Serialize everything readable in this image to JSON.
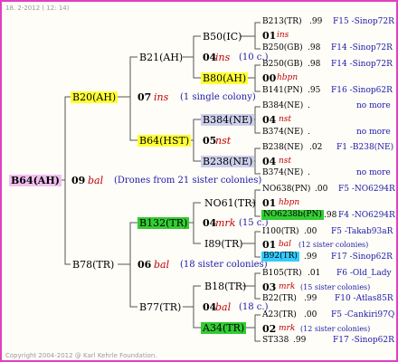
{
  "header": {
    "date_time": "18. 2-2012 ( 12: 14)"
  },
  "footer": {
    "copyright": "Copyright 2004-2012 @ Karl Kehrle Foundation."
  },
  "root": {
    "name": "B64(AH)",
    "gen": "09",
    "year": "bal",
    "note": "(Drones from 21 sister colonies)"
  },
  "mother": {
    "name": "B20(AH)",
    "gen": "07",
    "year": "ins",
    "note": "(1 single colony)"
  },
  "father": {
    "name": "B78(TR)",
    "gen": "06",
    "year": "bal",
    "note": "(18 sister colonies)"
  },
  "g3": {
    "b21": "B21(AH)",
    "b64hst": "B64(HST)",
    "b132": "B132(TR)",
    "b77": "B77(TR)"
  },
  "g4": {
    "b50": "B50(IC)",
    "b50_gen": "04",
    "b50_year": "ins",
    "b50_note": "(10 c.)",
    "b80": "B80(AH)",
    "b384": "B384(NE)",
    "b384_gen": "05",
    "b384_year": "nst",
    "b238": "B238(NE)",
    "no61": "NO61(TR)",
    "no61_gen": "04",
    "no61_year": "mrk",
    "no61_note": "(15 c.)",
    "i89": "I89(TR)",
    "b18": "B18(TR)",
    "b18_gen": "04",
    "b18_year": "bal",
    "b18_note": "(18 c.)",
    "a34": "A34(TR)"
  },
  "g5": [
    {
      "name": "B213(TR)",
      "pct": ".99",
      "ref": "F15 -Sinop72R"
    },
    {
      "gen": "01",
      "year": "ins"
    },
    {
      "name": "B250(GB)",
      "pct": ".98",
      "ref": "F14 -Sinop72R"
    },
    {
      "name": "B250(GB)",
      "pct": ".98",
      "ref": "F14 -Sinop72R"
    },
    {
      "gen": "00",
      "year": "hbpn"
    },
    {
      "name": "B141(PN)",
      "pct": ".95",
      "ref": "F16 -Sinop62R"
    },
    {
      "name": "B384(NE)",
      "pct": ".",
      "ref": "no more"
    },
    {
      "gen": "04",
      "year": "nst"
    },
    {
      "name": "B374(NE)",
      "pct": ".",
      "ref": "no more"
    },
    {
      "name": "B238(NE)",
      "pct": ".02",
      "ref": "F1 -B238(NE)"
    },
    {
      "gen": "04",
      "year": "nst"
    },
    {
      "name": "B374(NE)",
      "pct": ".",
      "ref": "no more"
    },
    {
      "name": "NO638(PN)",
      "pct": ".00",
      "ref": "F5 -NO6294R"
    },
    {
      "gen": "01",
      "year": "hbpn"
    },
    {
      "name": "NO6238b(PN)",
      "pct": ".98",
      "ref": "F4 -NO6294R"
    },
    {
      "name": "I100(TR)",
      "pct": ".00",
      "ref": "F5 -Takab93aR"
    },
    {
      "gen": "01",
      "year": "bal",
      "note": "(12 sister colonies)"
    },
    {
      "name": "B92(TR)",
      "pct": ".99",
      "ref": "F17 -Sinop62R"
    },
    {
      "name": "B105(TR)",
      "pct": ".01",
      "ref": "F6 -Old_Lady"
    },
    {
      "gen": "03",
      "year": "mrk",
      "note": "(15 sister colonies)"
    },
    {
      "name": "B22(TR)",
      "pct": ".99",
      "ref": "F10 -Atlas85R"
    },
    {
      "name": "A23(TR)",
      "pct": ".00",
      "ref": "F5 -Cankiri97Q"
    },
    {
      "gen": "02",
      "year": "mrk",
      "note": "(12 sister colonies)"
    },
    {
      "name": "ST338",
      "pct": ".99",
      "ref": "F17 -Sinop62R"
    }
  ],
  "colors": {
    "frame": "#e040c0",
    "yellow": "#ffff33",
    "green": "#33cc33",
    "lavender": "#cdd0ec",
    "cyan": "#33ccff",
    "pink": "#f0c0f0",
    "blue_text": "#1a1aa8",
    "red_text": "#c00000"
  }
}
